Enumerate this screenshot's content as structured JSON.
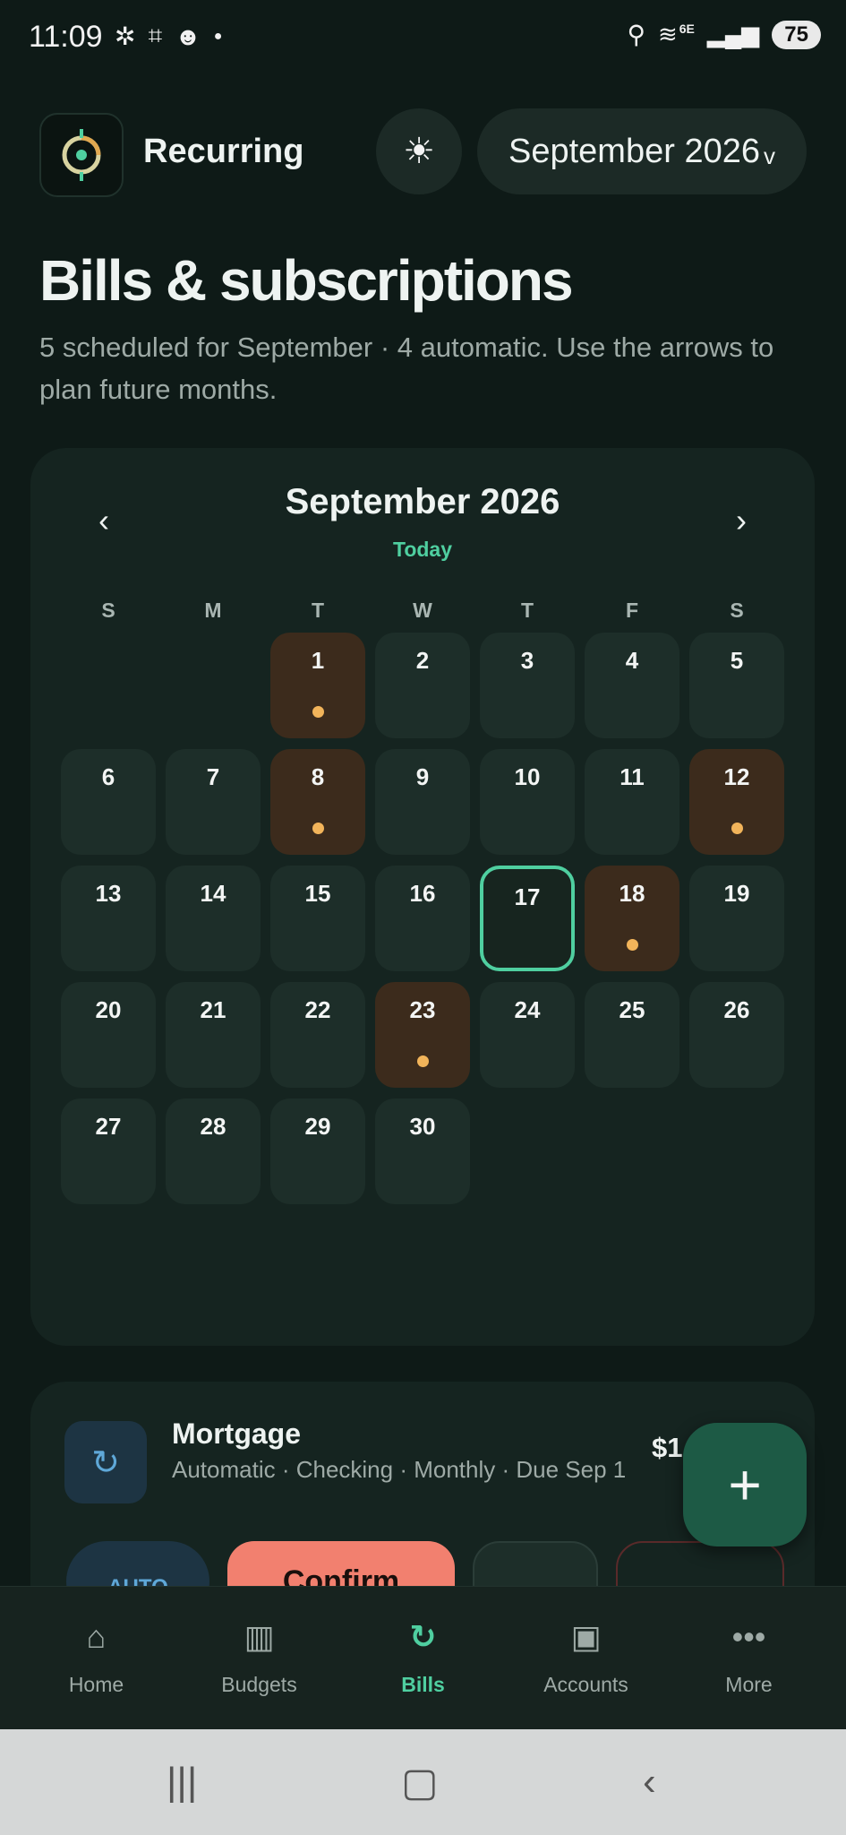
{
  "status_bar": {
    "time": "11:09",
    "network": "6E",
    "battery": "75",
    "icons": [
      "chatgpt-icon",
      "scan-icon",
      "reddit-icon",
      "dot-icon",
      "location-icon",
      "wifi-icon",
      "signal-icon"
    ]
  },
  "header": {
    "app_name": "Recurring",
    "theme_icon": "☀",
    "month_selector": "September 2026",
    "month_selector_chevron": "v"
  },
  "page": {
    "title": "Bills & subscriptions",
    "subtitle": "5 scheduled for September · 4 automatic. Use the arrows to plan future months."
  },
  "calendar": {
    "title": "September 2026",
    "today_label": "Today",
    "prev_label": "‹",
    "next_label": "›",
    "weekdays": [
      "S",
      "M",
      "T",
      "W",
      "T",
      "F",
      "S"
    ],
    "days": [
      "1",
      "2",
      "3",
      "4",
      "5",
      "6",
      "7",
      "8",
      "9",
      "10",
      "11",
      "12",
      "13",
      "14",
      "15",
      "16",
      "17",
      "18",
      "19",
      "20",
      "21",
      "22",
      "23",
      "24",
      "25",
      "26",
      "27",
      "28",
      "29",
      "30"
    ],
    "bill_days": [
      1,
      8,
      12,
      18,
      23
    ],
    "today": 17
  },
  "bill": {
    "name": "Mortgage",
    "meta": "Automatic · Checking · Monthly · Due Sep 1",
    "amount": "$1",
    "auto_label": "AUTO",
    "confirm_label": "Confirm"
  },
  "fab": {
    "label": "+"
  },
  "nav": {
    "items": [
      {
        "label": "Home",
        "icon": "⌂"
      },
      {
        "label": "Budgets",
        "icon": "▥"
      },
      {
        "label": "Bills",
        "icon": "↻"
      },
      {
        "label": "Accounts",
        "icon": "▣"
      },
      {
        "label": "More",
        "icon": "•••"
      }
    ],
    "active": "Bills"
  },
  "colors": {
    "background": "#0e1a17",
    "card": "#152420",
    "accent": "#4fcfa0",
    "bill_day": "#3c2b1c",
    "bill_dot": "#f2b45a",
    "confirm": "#f2806f"
  }
}
